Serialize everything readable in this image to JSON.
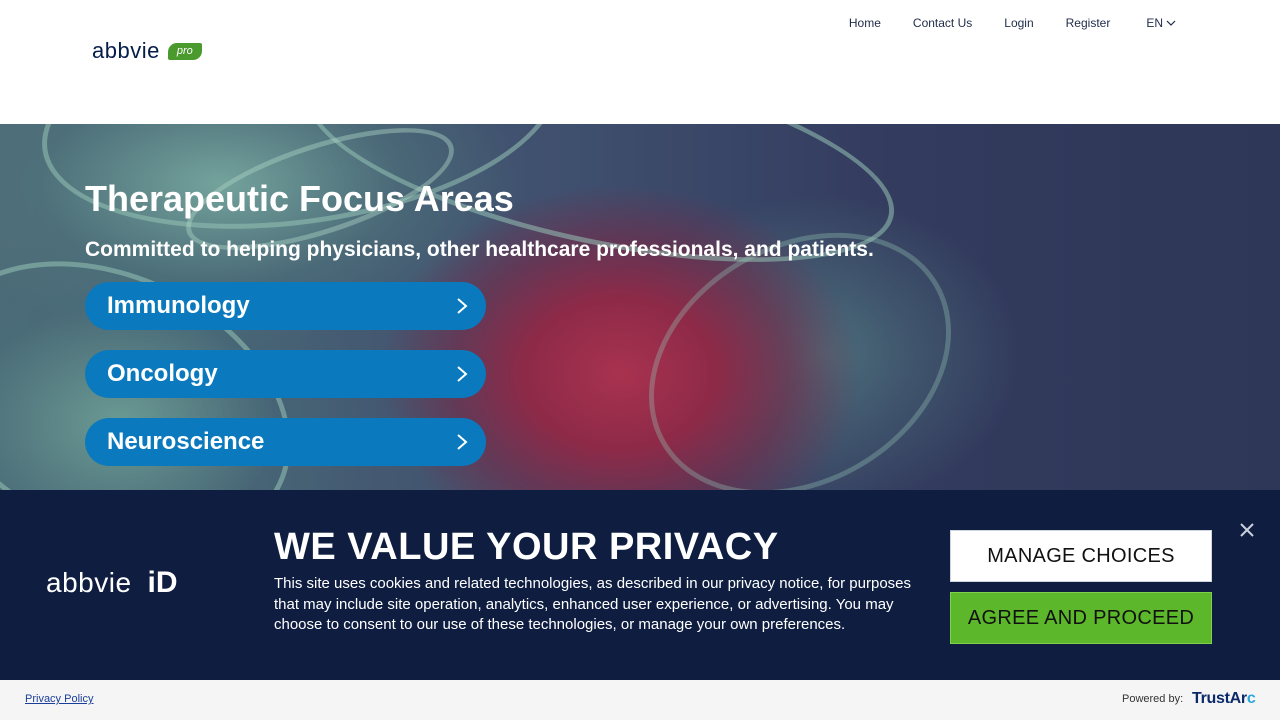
{
  "header": {
    "logo_word": "abbvie",
    "logo_badge": "pro",
    "nav": [
      {
        "label": "Home"
      },
      {
        "label": "Contact Us"
      },
      {
        "label": "Login"
      },
      {
        "label": "Register"
      }
    ],
    "language": "EN"
  },
  "hero": {
    "title": "Therapeutic Focus Areas",
    "subtitle": "Committed to helping physicians, other healthcare professionals, and patients.",
    "areas": [
      {
        "label": "Immunology"
      },
      {
        "label": "Oncology"
      },
      {
        "label": "Neuroscience"
      }
    ],
    "button_color": "#0a79bd"
  },
  "cookie_banner": {
    "logo_word": "abbvie",
    "logo_id": "iD",
    "title": "WE VALUE YOUR PRIVACY",
    "text": "This site uses cookies and related technologies, as described in our privacy notice, for purposes that may include site operation, analytics, enhanced user experience, or advertising. You may choose to consent to our use of these technologies, or manage your own preferences.",
    "manage_label": "MANAGE CHOICES",
    "agree_label": "AGREE AND PROCEED",
    "background": "#0f1e40",
    "agree_color": "#5cb82a"
  },
  "footer": {
    "privacy_link": "Privacy Policy",
    "powered_by": "Powered by:",
    "trustarc_main": "TrustAr",
    "trustarc_c": "c"
  }
}
